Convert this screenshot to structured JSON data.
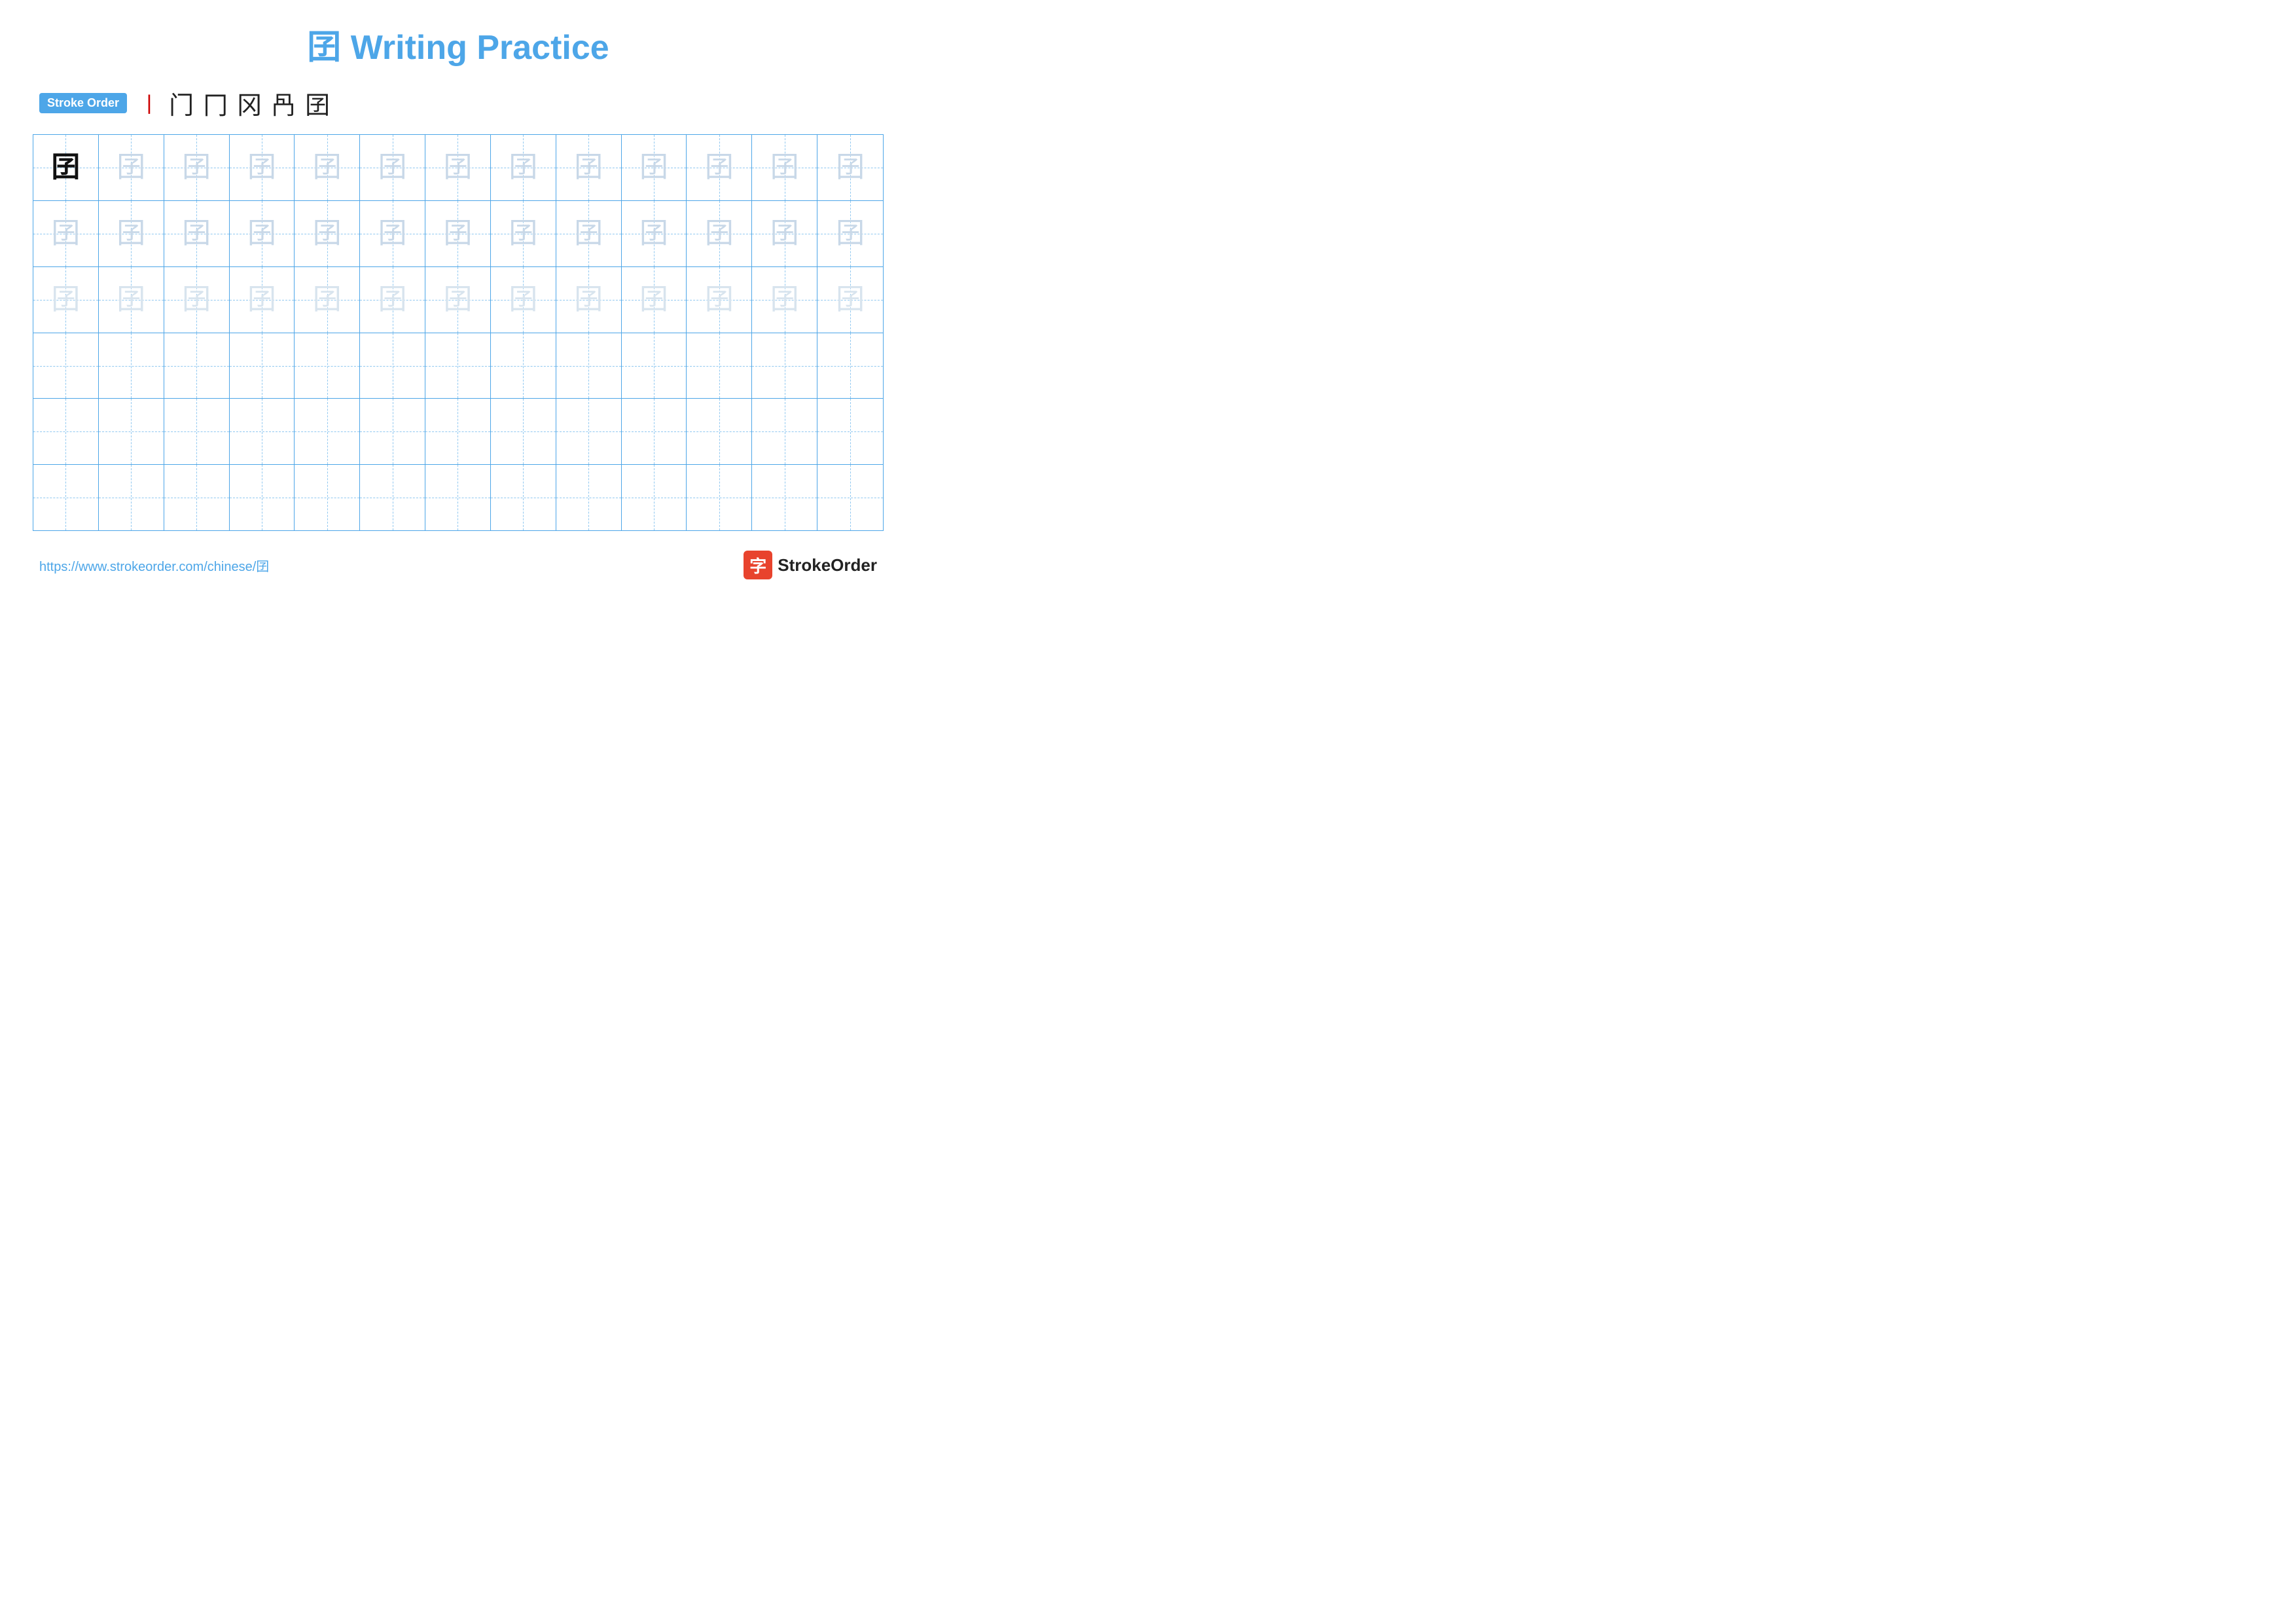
{
  "title": {
    "char": "囝",
    "text": "Writing Practice"
  },
  "stroke_order": {
    "badge_label": "Stroke Order",
    "steps": [
      "丨",
      "门",
      "冂",
      "冈",
      "冎",
      "囝"
    ]
  },
  "grid": {
    "rows": 6,
    "cols": 13,
    "char": "囝",
    "row_types": [
      "bold_then_light",
      "light",
      "lighter",
      "empty",
      "empty",
      "empty"
    ]
  },
  "footer": {
    "url": "https://www.strokeorder.com/chinese/囝",
    "logo_char": "字",
    "logo_text": "StrokeOrder"
  }
}
